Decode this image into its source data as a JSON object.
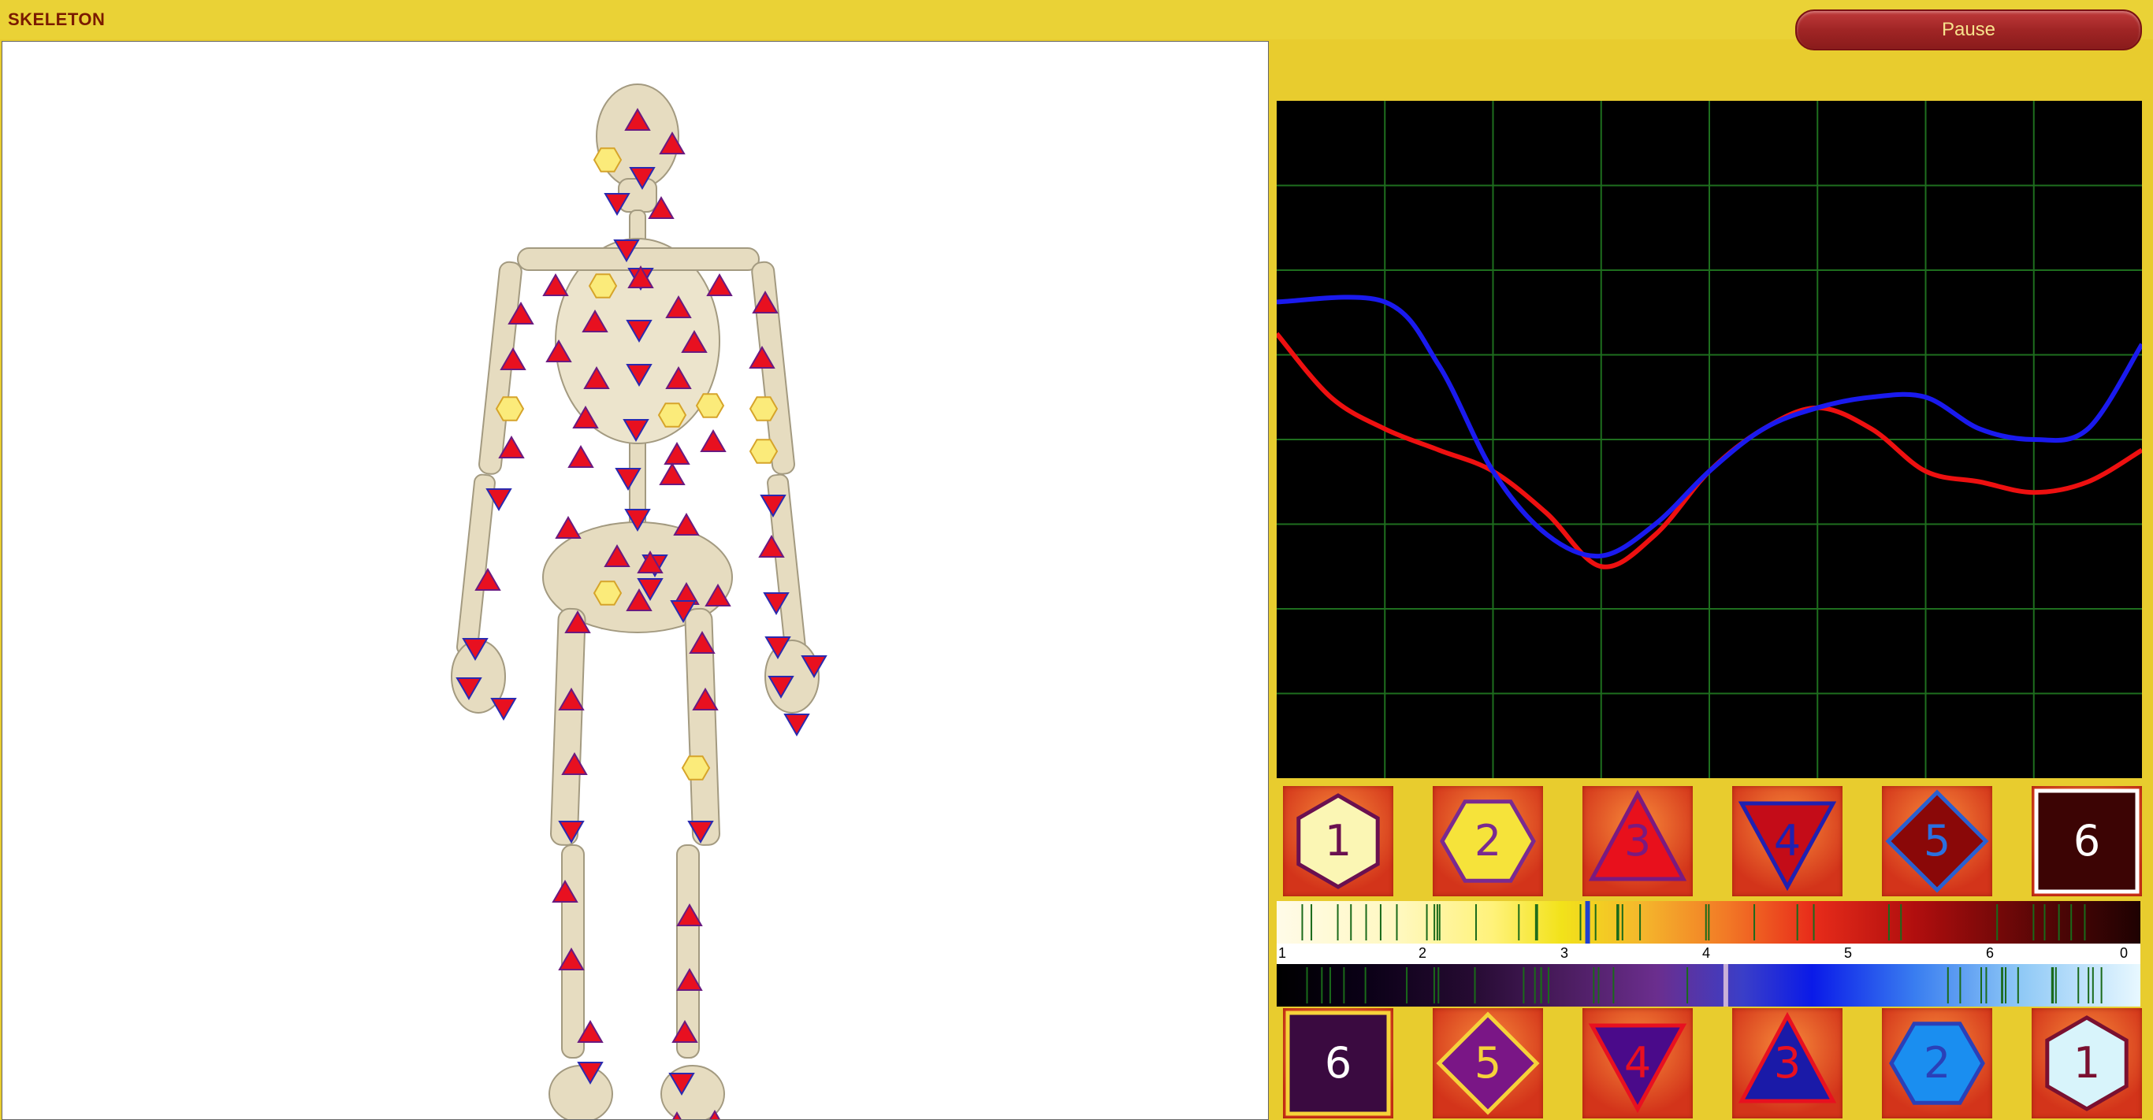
{
  "app": {
    "title": "SKELETON"
  },
  "toolbar": {
    "pause_label": "Pause"
  },
  "chart_data": {
    "type": "line",
    "title": "",
    "xlabel": "",
    "ylabel": "",
    "grid": true,
    "xlim": [
      0,
      8
    ],
    "ylim": [
      0,
      6.4
    ],
    "series": [
      {
        "color": "#1a1aee",
        "x": [
          0,
          1,
          1.5,
          2,
          2.5,
          3,
          3.5,
          4,
          4.5,
          5,
          5.5,
          6,
          6.5,
          7,
          7.5,
          8
        ],
        "y": [
          4.5,
          4.5,
          3.9,
          2.9,
          2.3,
          2.1,
          2.4,
          2.9,
          3.3,
          3.5,
          3.6,
          3.6,
          3.3,
          3.2,
          3.3,
          4.1
        ]
      },
      {
        "color": "#ee1010",
        "x": [
          0,
          0.5,
          1,
          1.5,
          2,
          2.5,
          3,
          3.5,
          4,
          4.5,
          5,
          5.5,
          6,
          6.5,
          7,
          7.5,
          8
        ],
        "y": [
          4.2,
          3.6,
          3.3,
          3.1,
          2.9,
          2.5,
          2.0,
          2.3,
          2.9,
          3.3,
          3.5,
          3.3,
          2.9,
          2.8,
          2.7,
          2.8,
          3.1
        ]
      }
    ]
  },
  "tiles": {
    "top": [
      {
        "label": "1",
        "shape": "hexagon",
        "fill": "#fbf6b4",
        "stroke": "#6a1050",
        "text_color": "#6a1050"
      },
      {
        "label": "2",
        "shape": "hexagon",
        "fill": "#f6e33a",
        "stroke": "#7a2a90",
        "text_color": "#7a2a90"
      },
      {
        "label": "3",
        "shape": "triangle-up",
        "fill": "#e8101c",
        "stroke": "#7a1a80",
        "text_color": "#7a1a80"
      },
      {
        "label": "4",
        "shape": "triangle-down",
        "fill": "#c40c18",
        "stroke": "#2020b0",
        "text_color": "#2020b0"
      },
      {
        "label": "5",
        "shape": "diamond",
        "fill": "#8a0808",
        "stroke": "#2a60d0",
        "text_color": "#2a70e0"
      },
      {
        "label": "6",
        "shape": "square",
        "fill": "#3c0404",
        "stroke": "#ffffff",
        "text_color": "#ffffff"
      }
    ],
    "bottom": [
      {
        "label": "6",
        "shape": "square",
        "fill": "#3a0a40",
        "stroke": "#f6d23a",
        "text_color": "#ffffff"
      },
      {
        "label": "5",
        "shape": "diamond",
        "fill": "#7a1686",
        "stroke": "#f6d23a",
        "text_color": "#f6d23a"
      },
      {
        "label": "4",
        "shape": "triangle-down",
        "fill": "#4a0a8a",
        "stroke": "#e81020",
        "text_color": "#e81020"
      },
      {
        "label": "3",
        "shape": "triangle-up",
        "fill": "#1a1aa8",
        "stroke": "#e81020",
        "text_color": "#e81020"
      },
      {
        "label": "2",
        "shape": "hexagon",
        "fill": "#1a8ef0",
        "stroke": "#2a40b8",
        "text_color": "#2a40b8"
      },
      {
        "label": "1",
        "shape": "hexagon",
        "fill": "#d8f4fb",
        "stroke": "#7a1030",
        "text_color": "#7a1030"
      }
    ]
  },
  "scale": {
    "labels": [
      "1",
      "2",
      "3",
      "4",
      "5",
      "6",
      "0"
    ],
    "warm_marker": 0.36,
    "cool_marker": 0.52
  },
  "markers": [
    [
      "up",
      806,
      100
    ],
    [
      "up",
      850,
      130
    ],
    [
      "hex",
      768,
      150
    ],
    [
      "down",
      812,
      172
    ],
    [
      "down",
      780,
      205
    ],
    [
      "up",
      836,
      212
    ],
    [
      "down",
      792,
      264
    ],
    [
      "down",
      810,
      300
    ],
    [
      "up",
      702,
      310
    ],
    [
      "hex",
      762,
      310
    ],
    [
      "up",
      810,
      300
    ],
    [
      "up",
      910,
      310
    ],
    [
      "up",
      968,
      332
    ],
    [
      "up",
      658,
      346
    ],
    [
      "up",
      752,
      356
    ],
    [
      "up",
      858,
      338
    ],
    [
      "down",
      808,
      366
    ],
    [
      "up",
      878,
      382
    ],
    [
      "up",
      706,
      394
    ],
    [
      "up",
      648,
      404
    ],
    [
      "up",
      754,
      428
    ],
    [
      "up",
      858,
      428
    ],
    [
      "down",
      808,
      422
    ],
    [
      "up",
      964,
      402
    ],
    [
      "hex",
      644,
      466
    ],
    [
      "up",
      740,
      478
    ],
    [
      "hex",
      850,
      474
    ],
    [
      "hex",
      898,
      462
    ],
    [
      "hex",
      966,
      466
    ],
    [
      "down",
      804,
      492
    ],
    [
      "up",
      646,
      516
    ],
    [
      "up",
      734,
      528
    ],
    [
      "up",
      856,
      524
    ],
    [
      "up",
      902,
      508
    ],
    [
      "hex",
      966,
      520
    ],
    [
      "down",
      794,
      554
    ],
    [
      "up",
      850,
      550
    ],
    [
      "down",
      630,
      580
    ],
    [
      "down",
      978,
      588
    ],
    [
      "up",
      718,
      618
    ],
    [
      "up",
      868,
      614
    ],
    [
      "down",
      806,
      606
    ],
    [
      "up",
      780,
      654
    ],
    [
      "down",
      828,
      664
    ],
    [
      "up",
      822,
      662
    ],
    [
      "up",
      616,
      684
    ],
    [
      "up",
      976,
      642
    ],
    [
      "hex",
      768,
      700
    ],
    [
      "down",
      822,
      694
    ],
    [
      "up",
      868,
      702
    ],
    [
      "up",
      808,
      710
    ],
    [
      "up",
      908,
      704
    ],
    [
      "down",
      864,
      722
    ],
    [
      "up",
      730,
      738
    ],
    [
      "up",
      888,
      764
    ],
    [
      "down",
      982,
      712
    ],
    [
      "down",
      600,
      770
    ],
    [
      "down",
      984,
      768
    ],
    [
      "up",
      722,
      836
    ],
    [
      "up",
      892,
      836
    ],
    [
      "down",
      1030,
      792
    ],
    [
      "down",
      592,
      820
    ],
    [
      "down",
      636,
      846
    ],
    [
      "down",
      988,
      818
    ],
    [
      "down",
      1008,
      866
    ],
    [
      "up",
      726,
      918
    ],
    [
      "hex",
      880,
      922
    ],
    [
      "down",
      722,
      1002
    ],
    [
      "down",
      886,
      1002
    ],
    [
      "up",
      714,
      1080
    ],
    [
      "up",
      872,
      1110
    ],
    [
      "up",
      722,
      1166
    ],
    [
      "up",
      872,
      1192
    ],
    [
      "up",
      746,
      1258
    ],
    [
      "up",
      866,
      1258
    ],
    [
      "down",
      746,
      1308
    ],
    [
      "down",
      862,
      1322
    ],
    [
      "down",
      738,
      1396
    ],
    [
      "up",
      856,
      1374
    ],
    [
      "up",
      904,
      1372
    ]
  ]
}
